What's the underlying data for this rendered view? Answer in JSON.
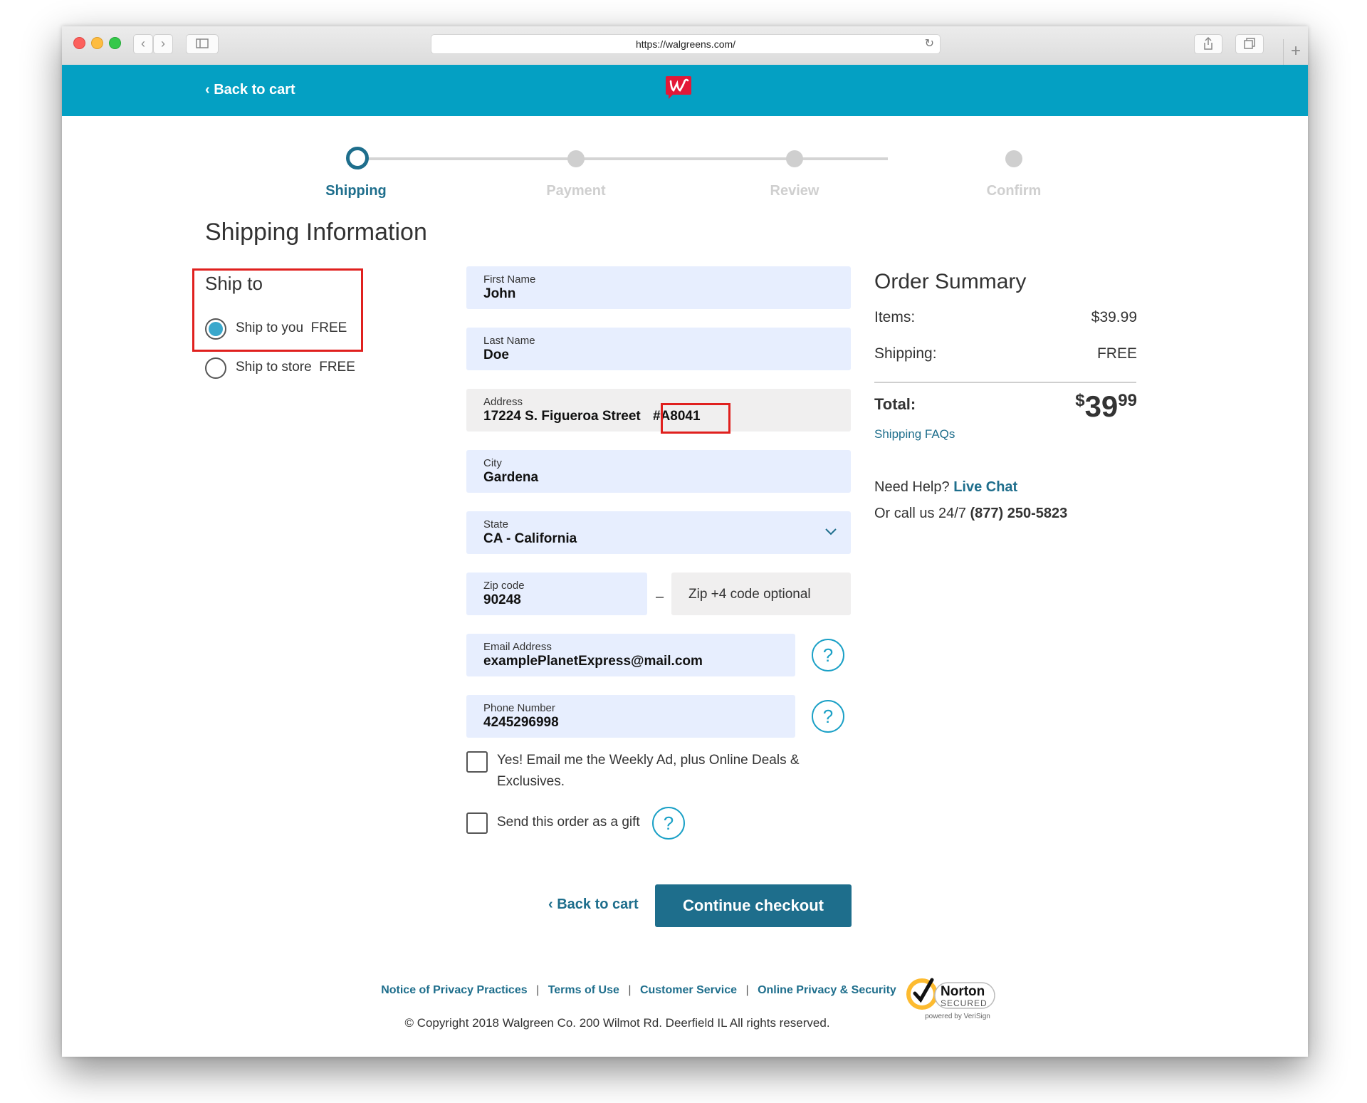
{
  "browser": {
    "url": "https://walgreens.com/"
  },
  "header": {
    "back_link": "‹ Back to cart"
  },
  "steps": [
    {
      "label": "Shipping",
      "active": true
    },
    {
      "label": "Payment",
      "active": false
    },
    {
      "label": "Review",
      "active": false
    },
    {
      "label": "Confirm",
      "active": false
    }
  ],
  "page_title": "Shipping Information",
  "ship_to": {
    "title": "Ship to",
    "options": [
      {
        "label": "Ship to you",
        "price": "FREE",
        "selected": true
      },
      {
        "label": "Ship to store",
        "price": "FREE",
        "selected": false
      }
    ]
  },
  "form": {
    "first_name": {
      "label": "First Name",
      "value": "John"
    },
    "last_name": {
      "label": "Last Name",
      "value": "Doe"
    },
    "address": {
      "label": "Address",
      "value": "17224 S. Figueroa Street",
      "suite": "#A8041"
    },
    "city": {
      "label": "City",
      "value": "Gardena"
    },
    "state": {
      "label": "State",
      "value": "CA - California"
    },
    "zip": {
      "label": "Zip code",
      "value": "90248"
    },
    "zip4": {
      "placeholder": "Zip +4 code optional"
    },
    "zip_separator": "–",
    "email": {
      "label": "Email Address",
      "value": "examplePlanetExpress@mail.com"
    },
    "phone": {
      "label": "Phone Number",
      "value": "4245296998"
    },
    "email_optin": {
      "label_line1": "Yes! Email me the Weekly Ad, plus Online Deals &",
      "label_line2": "Exclusives.",
      "checked": false
    },
    "gift": {
      "label": "Send this order as a gift",
      "checked": false
    },
    "help_symbol": "?"
  },
  "actions": {
    "back": "‹ Back to cart",
    "continue": "Continue checkout"
  },
  "summary": {
    "title": "Order Summary",
    "items_label": "Items:",
    "items_value": "$39.99",
    "shipping_label": "Shipping:",
    "shipping_value": "FREE",
    "total_label": "Total:",
    "total_currency": "$",
    "total_dollars": "39",
    "total_cents": "99",
    "faq_link": "Shipping FAQs",
    "need_help": "Need Help?",
    "live_chat": "Live Chat",
    "call_text": "Or call us 24/7",
    "phone": "(877) 250-5823"
  },
  "footer": {
    "links": [
      "Notice of Privacy Practices",
      "Terms of Use",
      "Customer Service",
      "Online Privacy & Security"
    ],
    "separator": "|",
    "copyright": "© Copyright 2018 Walgreen Co. 200 Wilmot Rd. Deerfield IL All rights reserved.",
    "norton_brand": "Norton",
    "norton_secured": "SECURED",
    "norton_powered": "powered by VeriSign"
  },
  "colors": {
    "header": "#04a0c3",
    "accent": "#1e6e8c",
    "highlight": "#e0201e",
    "field_bg": "#e7eefe"
  }
}
